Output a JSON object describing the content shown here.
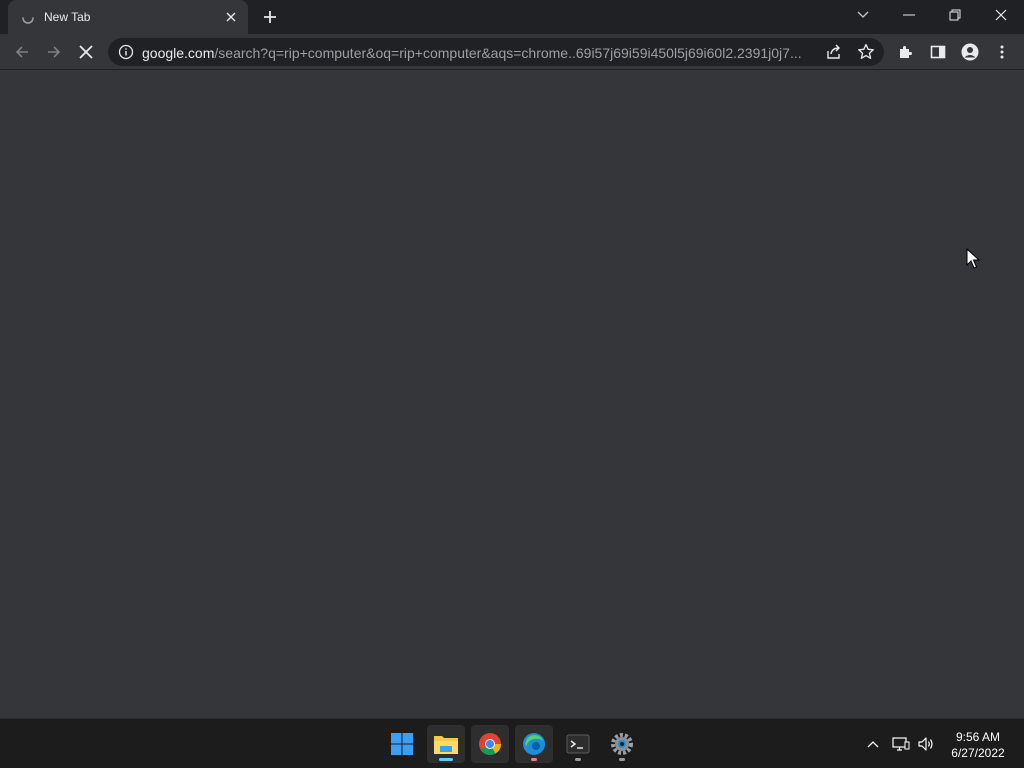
{
  "window": {
    "tab": {
      "title": "New Tab"
    },
    "controls": {
      "tab_search": "chevron-down-icon",
      "minimize": "minimize-icon",
      "restore": "restore-icon",
      "close": "close-icon"
    }
  },
  "toolbar": {
    "url_host": "google.com",
    "url_rest": "/search?q=rip+computer&oq=rip+computer&aqs=chrome..69i57j69i59i450l5j69i60l2.2391j0j7..."
  },
  "taskbar": {
    "apps": [
      "windows-start-icon",
      "file-explorer-icon",
      "chrome-icon",
      "edge-icon",
      "terminal-icon",
      "settings-icon"
    ],
    "clock": {
      "time": "9:56 AM",
      "date": "6/27/2022"
    }
  },
  "colors": {
    "titlebar": "#202124",
    "toolbar": "#35363a",
    "content": "#35363a",
    "taskbar": "#1c1c1c",
    "accent": "#8ab4f8"
  }
}
